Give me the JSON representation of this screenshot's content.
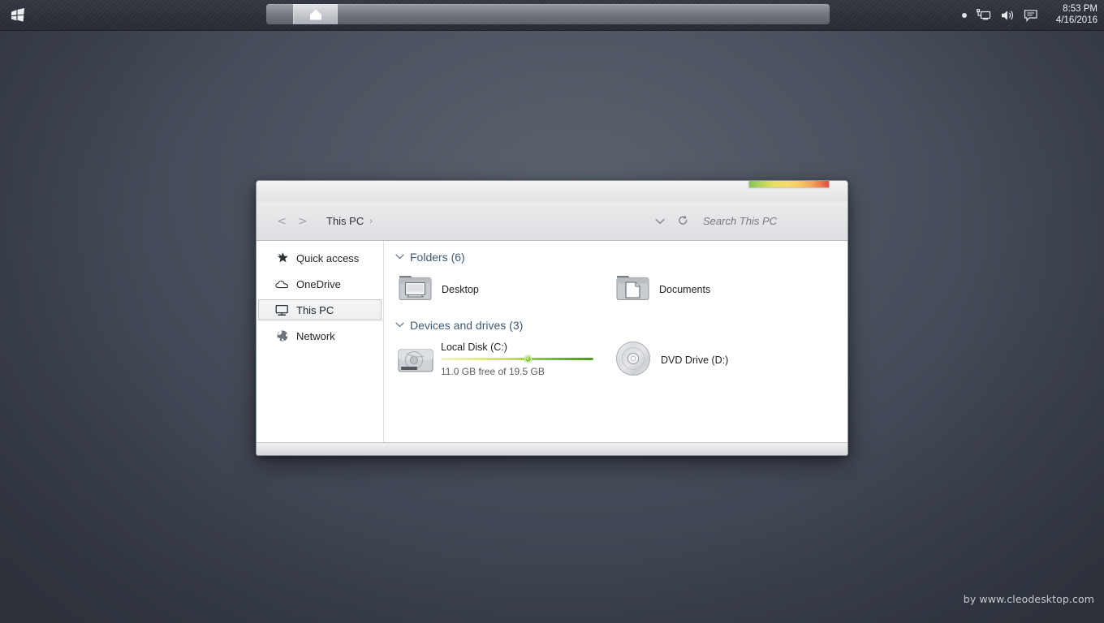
{
  "taskbar": {
    "start_logo_name": "windows-logo",
    "task_button_icon": "pentagon-home-icon",
    "tray": {
      "dot_name": "tray-dot",
      "network_icon": "network-icon",
      "volume_icon": "volume-icon",
      "notification_icon": "notification-icon",
      "time": "8:53 PM",
      "date": "4/16/2016"
    }
  },
  "desktop": {
    "watermark": "by www.cleodesktop.com",
    "background_color": "#4d5461"
  },
  "window": {
    "title": "This PC",
    "nav": {
      "back_label": "<",
      "forward_label": ">",
      "breadcrumb": "This PC",
      "breadcrumb_separator": "›",
      "history_chevron": "⌄",
      "refresh_icon": "refresh-icon",
      "search_placeholder": "Search This PC"
    },
    "sidebar": {
      "items": [
        {
          "label": "Quick access",
          "icon": "star-icon",
          "selected": false
        },
        {
          "label": "OneDrive",
          "icon": "cloud-icon",
          "selected": false
        },
        {
          "label": "This PC",
          "icon": "monitor-icon",
          "selected": true
        },
        {
          "label": "Network",
          "icon": "globe-network-icon",
          "selected": false
        }
      ]
    },
    "content": {
      "groups": [
        {
          "header": "Folders (6)",
          "type": "folders",
          "items": [
            {
              "label": "Desktop",
              "icon": "folder-desktop-icon"
            },
            {
              "label": "Documents",
              "icon": "folder-documents-icon"
            }
          ]
        },
        {
          "header": "Devices and drives (3)",
          "type": "drives",
          "items": [
            {
              "label": "Local Disk (C:)",
              "icon": "hard-disk-icon",
              "capacity_text": "11.0 GB free of 19.5 GB",
              "free_gb": 11.0,
              "total_gb": 19.5,
              "used_percent": 44
            },
            {
              "label": "DVD Drive (D:)",
              "icon": "optical-disc-icon"
            }
          ]
        }
      ]
    },
    "caption_gradient_colors": [
      "#7cc04a",
      "#e9e05a",
      "#f3a24f",
      "#e0392c"
    ]
  }
}
